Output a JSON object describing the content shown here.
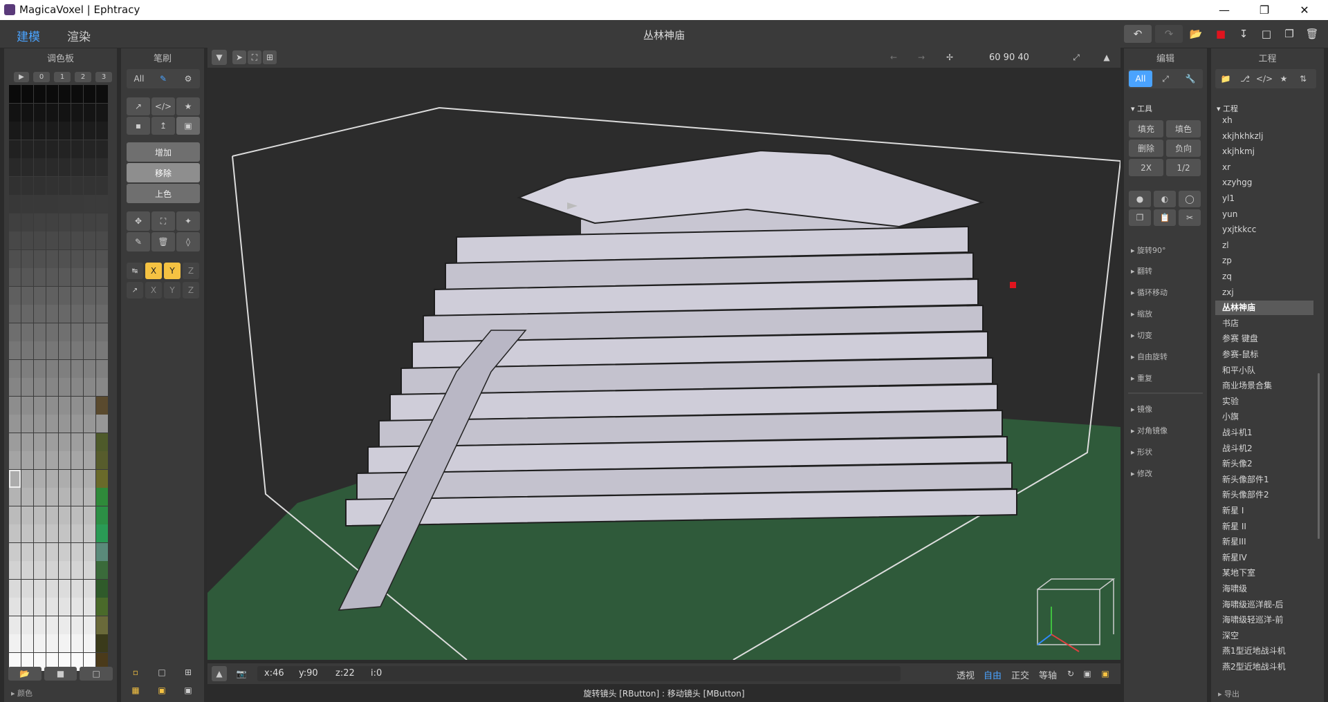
{
  "window": {
    "title": "MagicaVoxel | Ephtracy"
  },
  "modes": {
    "model": "建模",
    "render": "渲染"
  },
  "project_title": "丛林神庙",
  "palette": {
    "title": "调色板",
    "tabs": [
      "▶",
      "0",
      "1",
      "2",
      "3"
    ],
    "footer": "颜色"
  },
  "brush": {
    "title": "笔刷",
    "all": "All",
    "attach": "增加",
    "erase": "移除",
    "paint": "上色",
    "axes": [
      "X",
      "Y",
      "Z"
    ]
  },
  "viewport": {
    "dims": "60  90  40",
    "coords": {
      "x": "x:46",
      "y": "y:90",
      "z": "z:22",
      "i": "i:0"
    },
    "views": [
      "透视",
      "自由",
      "正交",
      "等轴"
    ],
    "hint": "旋转镜头 [RButton] : 移动镜头 [MButton]"
  },
  "edit": {
    "title": "编辑",
    "all": "All",
    "tools_header": "▾ 工具",
    "buttons": [
      "填充",
      "填色",
      "删除",
      "负向",
      "2X",
      "1/2"
    ],
    "sections": [
      "旋转90°",
      "翻转",
      "循环移动",
      "缩放",
      "切变",
      "自由旋转",
      "重复",
      "镜像",
      "对角镜像",
      "形状",
      "修改"
    ]
  },
  "project": {
    "title": "工程",
    "header": "▾ 工程",
    "footer": "导出",
    "items": [
      "xh",
      "xkjhkhkzlj",
      "xkjhkmj",
      "xr",
      "xzyhgg",
      "yl1",
      "yun",
      "yxjtkkcc",
      "zl",
      "zp",
      "zq",
      "zxj",
      "丛林神庙",
      "书店",
      "参赛 键盘",
      "参赛-鼠标",
      "和平小队",
      "商业场景合集",
      "实验",
      "小旗",
      "战斗机1",
      "战斗机2",
      "新头像2",
      "新头像部件1",
      "新头像部件2",
      "新星 I",
      "新星 II",
      "新星III",
      "新星IV",
      "某地下室",
      "海啸级",
      "海啸级巡洋舰-后",
      "海啸级轻巡洋-前",
      "深空",
      "燕1型近地战斗机",
      "燕2型近地战斗机"
    ],
    "selected": "丛林神庙"
  },
  "colors": {
    "accent": "#4aa3ff",
    "panel": "#3a3a3a",
    "axis_active": "#f5c242",
    "selection_red": "#e0141e",
    "ground": "#2f5a3a"
  }
}
